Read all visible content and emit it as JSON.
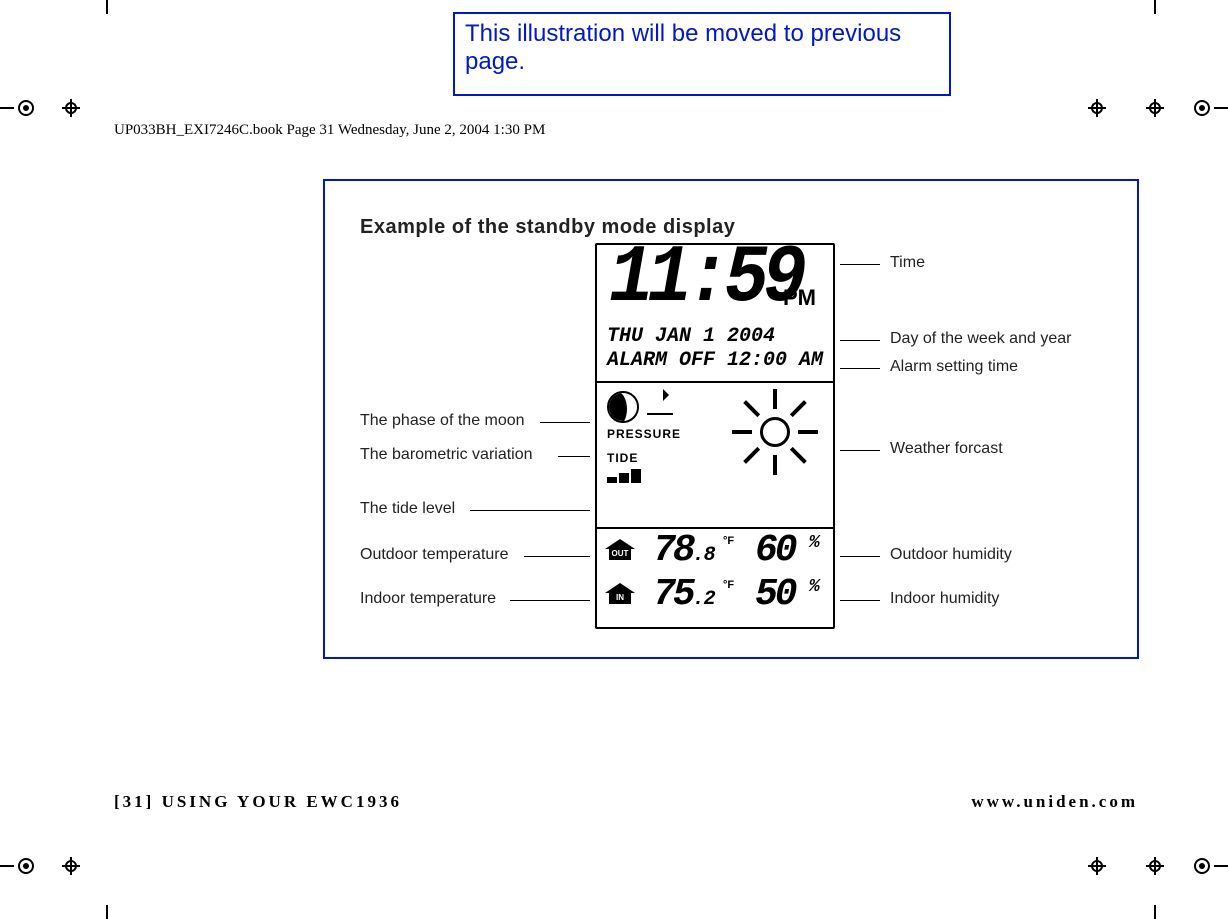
{
  "note": "This illustration will be moved to previous page.",
  "running_header": "UP033BH_EXI7246C.book  Page 31  Wednesday, June 2, 2004  1:30 PM",
  "section_title": "Example of the standby mode display",
  "lcd": {
    "time": "11:59",
    "ampm": "PM",
    "date_line": "THU JAN   1 2004",
    "alarm_line": "ALARM OFF 12:00 AM",
    "pressure_label": "PRESSURE",
    "tide_label": "TIDE",
    "out_tag": "OUT",
    "in_tag": "IN",
    "out_temp_main": "78",
    "out_temp_dec": ".8",
    "out_temp_unit": "°F",
    "out_hum": "60",
    "out_hum_unit": "%",
    "in_temp_main": "75",
    "in_temp_dec": ".2",
    "in_temp_unit": "°F",
    "in_hum": "50",
    "in_hum_unit": "%"
  },
  "callouts": {
    "time": "Time",
    "day_year": "Day of the week and year",
    "alarm": "Alarm setting time",
    "weather": "Weather forcast",
    "out_hum": "Outdoor humidity",
    "in_hum": "Indoor humidity",
    "moon": "The phase of the moon",
    "baro": "The barometric variation",
    "tide": "The tide level",
    "out_temp": "Outdoor temperature",
    "in_temp": "Indoor temperature"
  },
  "footer": {
    "left": "[31] USING YOUR EWC1936",
    "right": "www.uniden.com"
  }
}
